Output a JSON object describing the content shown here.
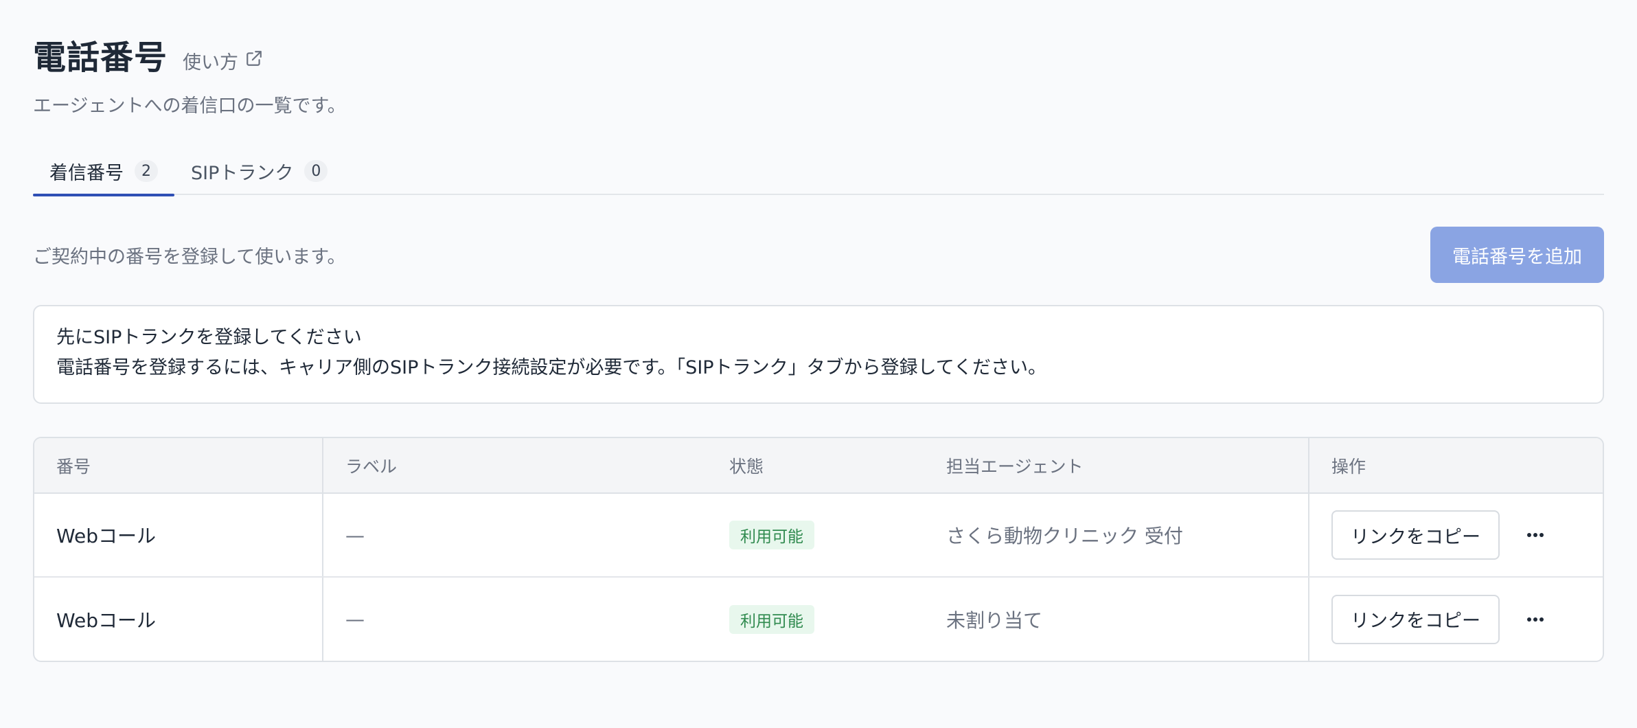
{
  "header": {
    "title": "電話番号",
    "help_link": "使い方",
    "subtitle": "エージェントへの着信口の一覧です。"
  },
  "tabs": [
    {
      "label": "着信番号",
      "count": "2",
      "active": true
    },
    {
      "label": "SIPトランク",
      "count": "0",
      "active": false
    }
  ],
  "section": {
    "description": "ご契約中の番号を登録して使います。",
    "add_button": "電話番号を追加"
  },
  "notice": {
    "title": "先にSIPトランクを登録してください",
    "body": "電話番号を登録するには、キャリア側のSIPトランク接続設定が必要です。「SIPトランク」タブから登録してください。"
  },
  "table": {
    "columns": [
      "番号",
      "ラベル",
      "状態",
      "担当エージェント",
      "操作"
    ],
    "rows": [
      {
        "number": "Webコール",
        "label": "—",
        "status": "利用可能",
        "agent": "さくら動物クリニック 受付",
        "action": "リンクをコピー"
      },
      {
        "number": "Webコール",
        "label": "—",
        "status": "利用可能",
        "agent": "未割り当て",
        "action": "リンクをコピー"
      }
    ]
  },
  "icons": {
    "help": "external-link-icon",
    "more": "more-horizontal-icon"
  },
  "colors": {
    "accent": "#2f4fb5",
    "primary_button_disabled": "#8aa4e3",
    "status_bg": "#e8f7ed",
    "status_text": "#2f8a4e"
  }
}
